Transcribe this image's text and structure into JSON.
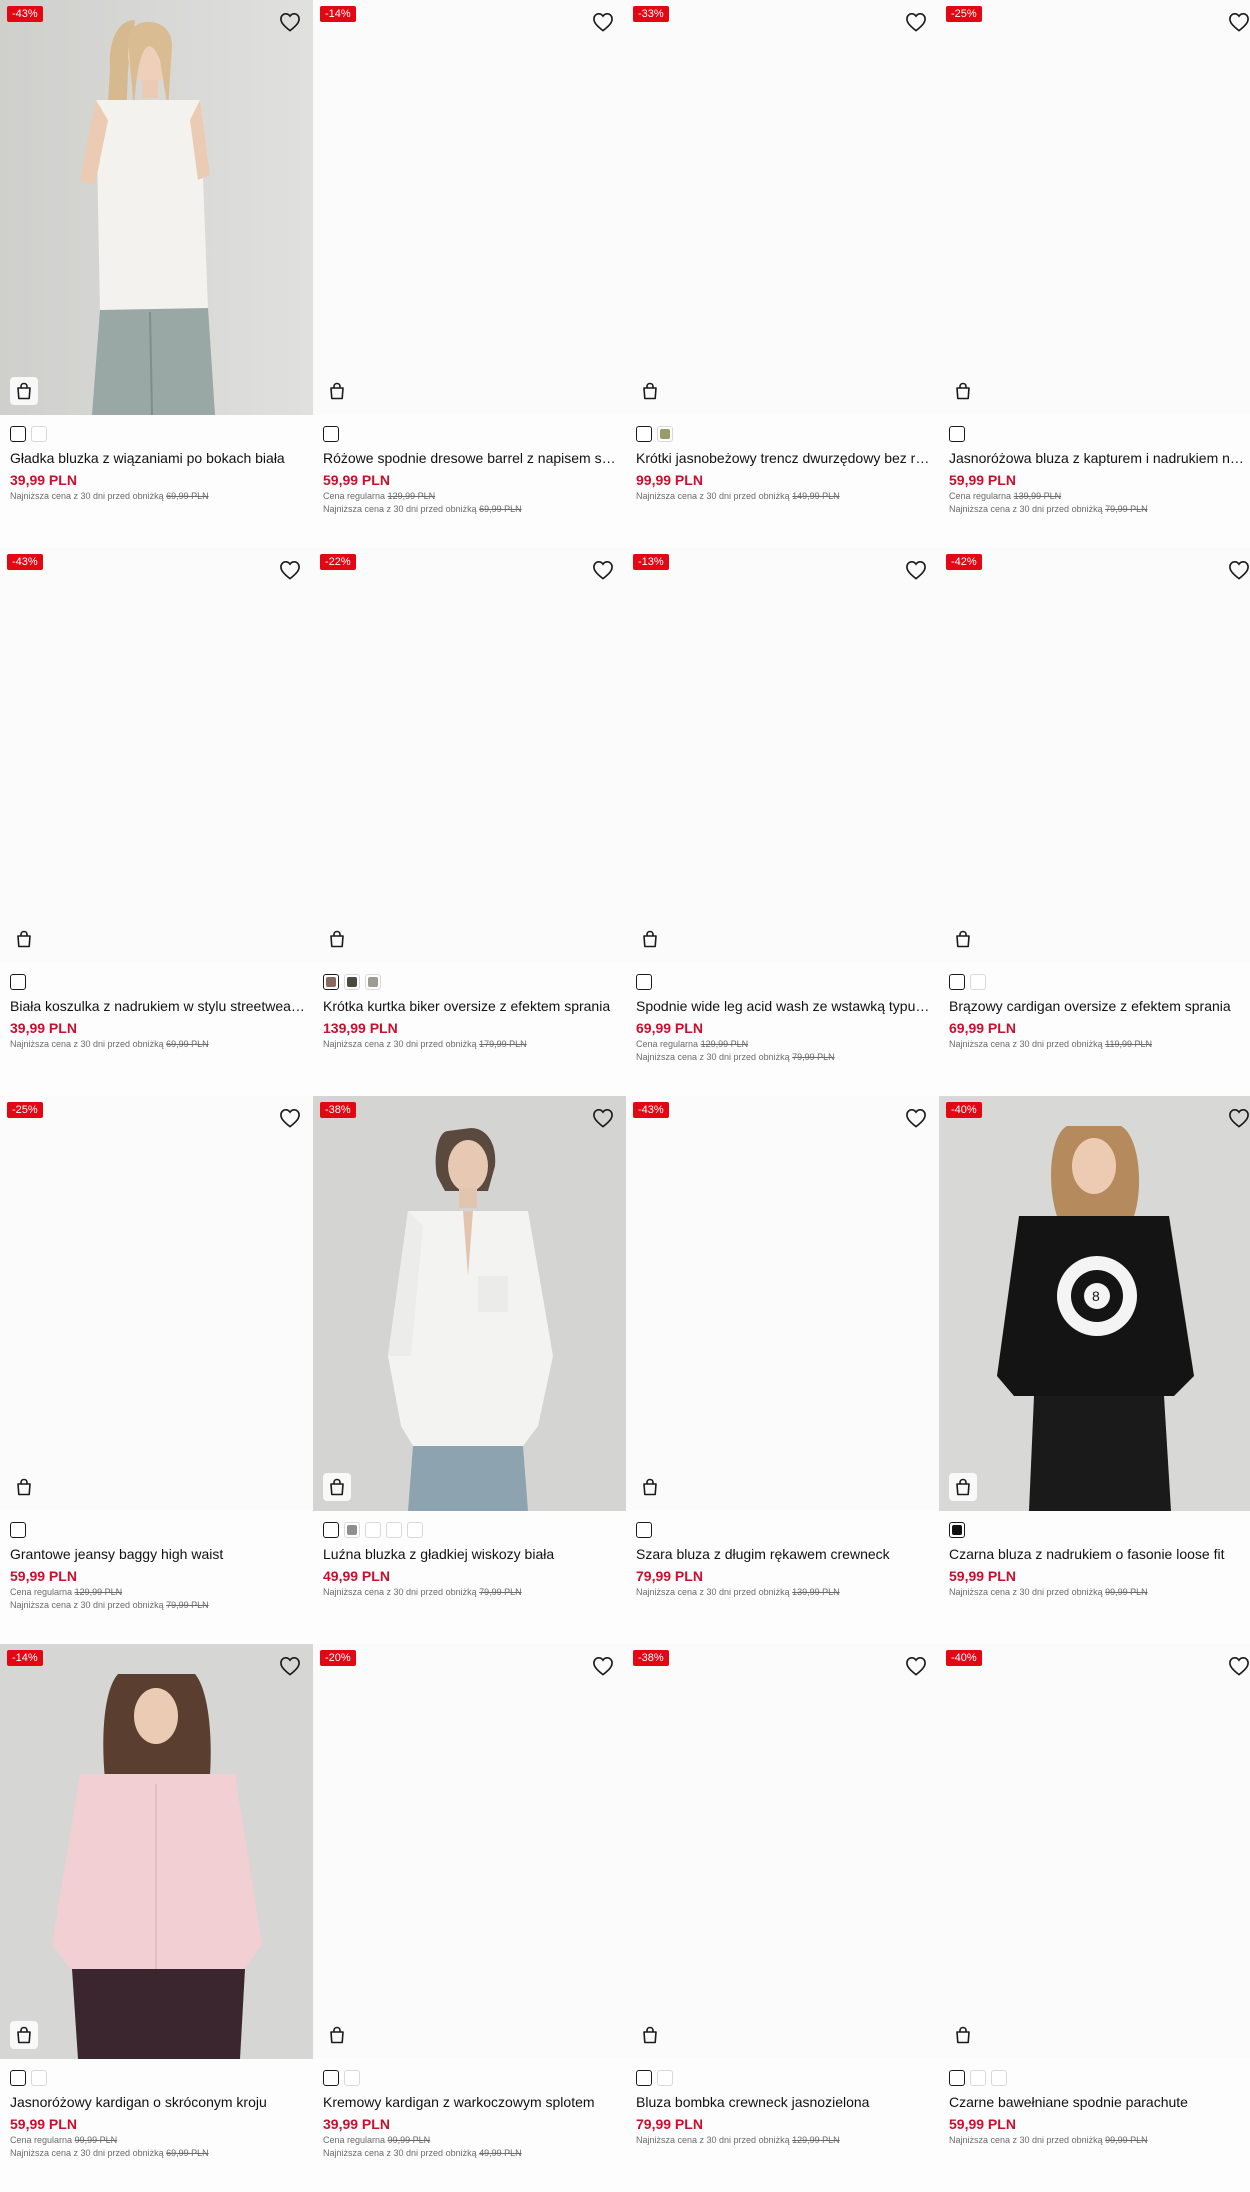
{
  "colors": {
    "badge": "#e30613",
    "price": "#c8102e"
  },
  "icons": {
    "favorite": "heart-icon",
    "cart": "shopping-bag-icon"
  },
  "products": [
    {
      "discount": "-43%",
      "name": "Gładka bluzka z wiązaniami po bokach biała",
      "price": "39,99 PLN",
      "regular_label": "",
      "regular_price": "",
      "lowest_label": "Najniższa cena z 30 dni przed obniżką",
      "lowest_price": "69,99 PLN",
      "swatches": [
        "#ffffff",
        "#ffffff"
      ],
      "selected": 0,
      "photo": "white-top"
    },
    {
      "discount": "-14%",
      "name": "Różowe spodnie dresowe barrel z napisem sportowym",
      "price": "59,99 PLN",
      "regular_label": "Cena regularna",
      "regular_price": "129,99 PLN",
      "lowest_label": "Najniższa cena z 30 dni przed obniżką",
      "lowest_price": "69,99 PLN",
      "swatches": [
        "#ffffff"
      ],
      "selected": 0,
      "photo": ""
    },
    {
      "discount": "-33%",
      "name": "Krótki jasnobeżowy trencz dwurzędowy bez rękawów",
      "price": "99,99 PLN",
      "regular_label": "",
      "regular_price": "",
      "lowest_label": "Najniższa cena z 30 dni przed obniżką",
      "lowest_price": "149,99 PLN",
      "swatches": [
        "#ffffff",
        "#9a9a6a"
      ],
      "selected": 0,
      "photo": ""
    },
    {
      "discount": "-25%",
      "name": "Jasnoróżowa bluza z kapturem i nadrukiem na plecach",
      "price": "59,99 PLN",
      "regular_label": "Cena regularna",
      "regular_price": "139,99 PLN",
      "lowest_label": "Najniższa cena z 30 dni przed obniżką",
      "lowest_price": "79,99 PLN",
      "swatches": [
        "#ffffff"
      ],
      "selected": 0,
      "photo": ""
    },
    {
      "discount": "-43%",
      "name": "Biała koszulka z nadrukiem w stylu streetwear oversize",
      "price": "39,99 PLN",
      "regular_label": "",
      "regular_price": "",
      "lowest_label": "Najniższa cena z 30 dni przed obniżką",
      "lowest_price": "69,99 PLN",
      "swatches": [
        "#ffffff"
      ],
      "selected": 0,
      "photo": ""
    },
    {
      "discount": "-22%",
      "name": "Krótka kurtka biker oversize z efektem sprania",
      "price": "139,99 PLN",
      "regular_label": "",
      "regular_price": "",
      "lowest_label": "Najniższa cena z 30 dni przed obniżką",
      "lowest_price": "179,99 PLN",
      "swatches": [
        "#8a6a5e",
        "#4a4a3c",
        "#9c9c92"
      ],
      "selected": 0,
      "photo": ""
    },
    {
      "discount": "-13%",
      "name": "Spodnie wide leg acid wash ze wstawką typu cargo",
      "price": "69,99 PLN",
      "regular_label": "Cena regularna",
      "regular_price": "129,99 PLN",
      "lowest_label": "Najniższa cena z 30 dni przed obniżką",
      "lowest_price": "79,99 PLN",
      "swatches": [
        "#ffffff"
      ],
      "selected": 0,
      "photo": ""
    },
    {
      "discount": "-42%",
      "name": "Brązowy cardigan oversize z efektem sprania",
      "price": "69,99 PLN",
      "regular_label": "",
      "regular_price": "",
      "lowest_label": "Najniższa cena z 30 dni przed obniżką",
      "lowest_price": "119,99 PLN",
      "swatches": [
        "#ffffff",
        "#ffffff"
      ],
      "selected": 0,
      "photo": ""
    },
    {
      "discount": "-25%",
      "name": "Grantowe jeansy baggy high waist",
      "price": "59,99 PLN",
      "regular_label": "Cena regularna",
      "regular_price": "129,99 PLN",
      "lowest_label": "Najniższa cena z 30 dni przed obniżką",
      "lowest_price": "79,99 PLN",
      "swatches": [
        "#ffffff"
      ],
      "selected": 0,
      "photo": ""
    },
    {
      "discount": "-38%",
      "name": "Luźna bluzka z gładkiej wiskozy biała",
      "price": "49,99 PLN",
      "regular_label": "",
      "regular_price": "",
      "lowest_label": "Najniższa cena z 30 dni przed obniżką",
      "lowest_price": "79,99 PLN",
      "swatches": [
        "#ffffff",
        "#8e8e8e",
        "#ffffff",
        "#ffffff",
        "#ffffff"
      ],
      "selected": 0,
      "photo": "white-blouse"
    },
    {
      "discount": "-43%",
      "name": "Szara bluza z długim rękawem crewneck",
      "price": "79,99 PLN",
      "regular_label": "",
      "regular_price": "",
      "lowest_label": "Najniższa cena z 30 dni przed obniżką",
      "lowest_price": "139,99 PLN",
      "swatches": [
        "#ffffff"
      ],
      "selected": 0,
      "photo": ""
    },
    {
      "discount": "-40%",
      "name": "Czarna bluza z nadrukiem o fasonie loose fit",
      "price": "59,99 PLN",
      "regular_label": "",
      "regular_price": "",
      "lowest_label": "Najniższa cena z 30 dni przed obniżką",
      "lowest_price": "99,99 PLN",
      "swatches": [
        "#111111"
      ],
      "selected": 0,
      "photo": "black-hoodie"
    },
    {
      "discount": "-14%",
      "name": "Jasnoróżowy kardigan o skróconym kroju",
      "price": "59,99 PLN",
      "regular_label": "Cena regularna",
      "regular_price": "99,99 PLN",
      "lowest_label": "Najniższa cena z 30 dni przed obniżką",
      "lowest_price": "69,99 PLN",
      "swatches": [
        "#ffffff",
        "#ffffff"
      ],
      "selected": 0,
      "photo": "pink-cardigan"
    },
    {
      "discount": "-20%",
      "name": "Kremowy kardigan z warkoczowym splotem",
      "price": "39,99 PLN",
      "regular_label": "Cena regularna",
      "regular_price": "99,99 PLN",
      "lowest_label": "Najniższa cena z 30 dni przed obniżką",
      "lowest_price": "49,99 PLN",
      "swatches": [
        "#ffffff",
        "#ffffff"
      ],
      "selected": 0,
      "photo": ""
    },
    {
      "discount": "-38%",
      "name": "Bluza bombka crewneck jasnozielona",
      "price": "79,99 PLN",
      "regular_label": "",
      "regular_price": "",
      "lowest_label": "Najniższa cena z 30 dni przed obniżką",
      "lowest_price": "129,99 PLN",
      "swatches": [
        "#ffffff",
        "#ffffff"
      ],
      "selected": 0,
      "photo": ""
    },
    {
      "discount": "-40%",
      "name": "Czarne bawełniane spodnie parachute",
      "price": "59,99 PLN",
      "regular_label": "",
      "regular_price": "",
      "lowest_label": "Najniższa cena z 30 dni przed obniżką",
      "lowest_price": "99,99 PLN",
      "swatches": [
        "#ffffff",
        "#ffffff",
        "#ffffff"
      ],
      "selected": 0,
      "photo": ""
    }
  ]
}
